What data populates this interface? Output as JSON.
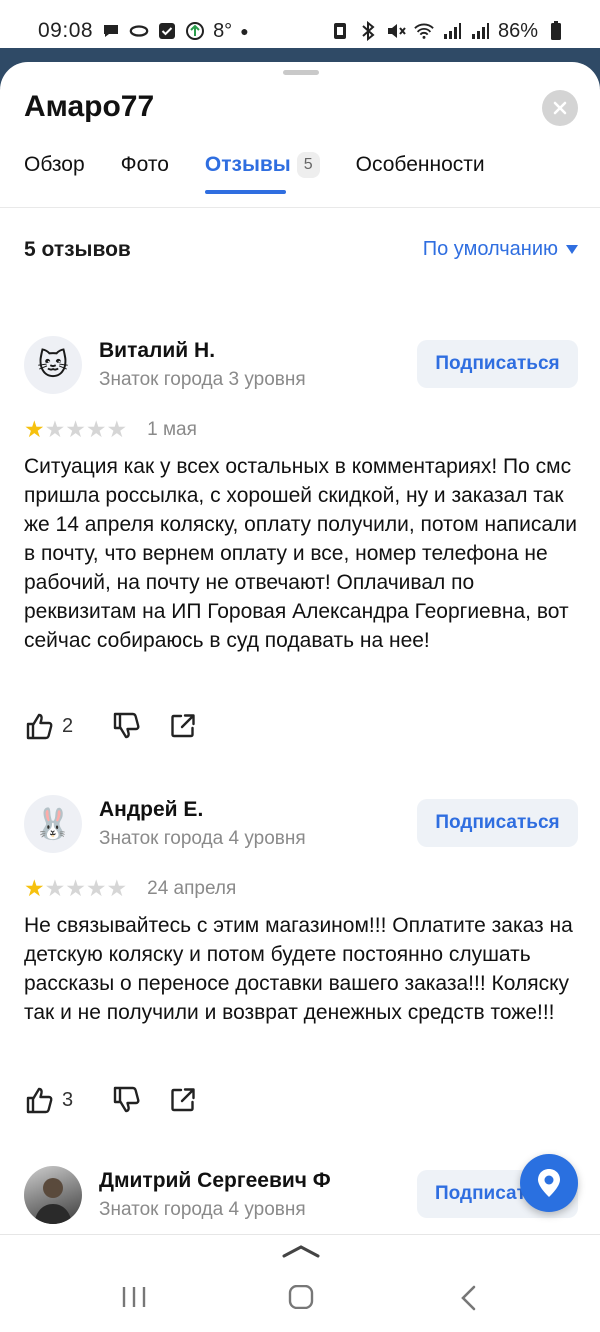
{
  "status_bar": {
    "time": "09:08",
    "temperature": "8°",
    "battery": "86%"
  },
  "sheet": {
    "title": "Амаро77",
    "tabs": [
      {
        "label": "Обзор",
        "active": false
      },
      {
        "label": "Фото",
        "active": false
      },
      {
        "label": "Отзывы",
        "active": true,
        "badge": "5"
      },
      {
        "label": "Особенности",
        "active": false
      }
    ],
    "reviews_count": "5 отзывов",
    "sort_label": "По умолчанию"
  },
  "reviews": [
    {
      "author": "Виталий Н.",
      "level": "Знаток города 3 уровня",
      "avatar_icon": "cat-face-emoji",
      "rating": 1,
      "rating_max": 5,
      "date": "1 мая",
      "text": "Ситуация как у всех остальных в комментариях! По смс пришла россылка, с хорошей скидкой, ну и заказал так же 14 апреля коляску, оплату получили, потом написали в почту, что вернем оплату и все, номер телефона не рабочий, на почту не отвечают! Оплачивал по реквизитам на ИП Горовая Александра Георгиевна, вот сейчас собираюсь в суд подавать на нее!",
      "likes": "2",
      "subscribe_label": "Подписаться"
    },
    {
      "author": "Андрей Е.",
      "level": "Знаток города 4 уровня",
      "avatar_icon": "rabbit-face-emoji",
      "rating": 1,
      "rating_max": 5,
      "date": "24 апреля",
      "text": "Не связывайтесь с этим магазином!!! Оплатите заказ на детскую коляску и потом будете постоянно слушать рассказы о переносе доставки вашего заказа!!! Коляску так и не получили и возврат денежных средств тоже!!!",
      "likes": "3",
      "subscribe_label": "Подписаться"
    },
    {
      "author": "Дмитрий Сергеевич Ф",
      "level": "Знаток города 4 уровня",
      "avatar_icon": "user-photo",
      "subscribe_label": "Подписат"
    }
  ],
  "colors": {
    "accent": "#2f6ee0",
    "star_on": "#f6c10e",
    "star_off": "#d6d6d6",
    "muted_text": "#8a8a8a"
  },
  "icons": [
    "thumb-up-icon",
    "thumb-down-icon",
    "share-icon",
    "close-icon",
    "map-pin-icon",
    "chevron-up-icon",
    "recent-apps-icon",
    "home-icon",
    "back-icon"
  ]
}
